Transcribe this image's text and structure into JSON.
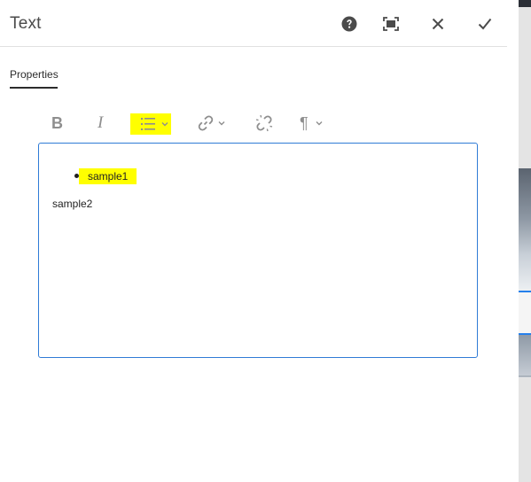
{
  "dialog": {
    "title": "Text",
    "header_icons": [
      "help-icon",
      "fullscreen-icon",
      "close-icon",
      "done-icon"
    ]
  },
  "tabs": [
    {
      "label": "Properties",
      "active": true
    }
  ],
  "toolbar": {
    "bold_label": "B",
    "italic_label": "I",
    "list_highlight_color": "#ffff00",
    "paragraph_label": "¶"
  },
  "editor": {
    "list_items": [
      {
        "text": "sample1",
        "highlight": "#ffff00"
      }
    ],
    "paragraphs": [
      "sample2"
    ],
    "border_color": "#2f7bd6"
  }
}
